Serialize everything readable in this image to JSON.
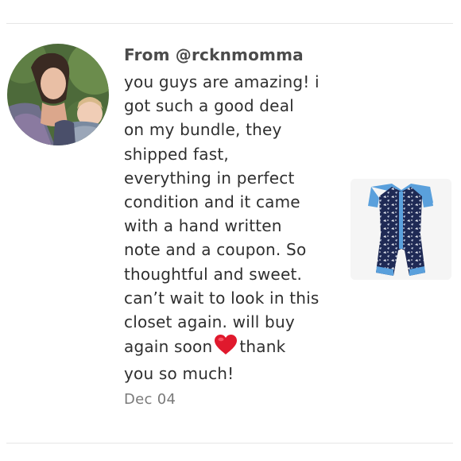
{
  "review": {
    "from": "From @rcknmomma",
    "message_lines": [
      "you guys are amazing! i",
      "got such a good deal",
      "on my bundle, they",
      "shipped fast,",
      "everything in perfect",
      "condition and it came",
      "with a hand written",
      "note and a coupon. So",
      "thoughtful and sweet.",
      "can’t wait to look in this",
      "closet again. will buy"
    ],
    "line_12_before": "again soon",
    "line_12_after": "thank",
    "line_13": "you so much!",
    "heart_icon": "red-heart-emoji",
    "date": "Dec 04"
  },
  "colors": {
    "heart": "#e0192d",
    "text": "#2f2f2f",
    "muted": "#7a7a7a"
  }
}
